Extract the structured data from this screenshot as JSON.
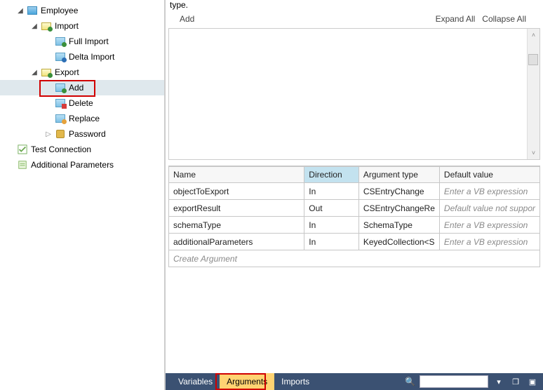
{
  "tree": {
    "root": "Employee",
    "import": {
      "label": "Import",
      "full": "Full Import",
      "delta": "Delta Import"
    },
    "export": {
      "label": "Export",
      "add": "Add",
      "delete": "Delete",
      "replace": "Replace",
      "password": "Password"
    },
    "testConnection": "Test Connection",
    "additionalParams": "Additional Parameters"
  },
  "remnant": "type.",
  "toolbar": {
    "add": "Add",
    "expandAll": "Expand All",
    "collapseAll": "Collapse All"
  },
  "grid": {
    "headers": {
      "name": "Name",
      "direction": "Direction",
      "argType": "Argument type",
      "defaultVal": "Default value"
    },
    "rows": [
      {
        "name": "objectToExport",
        "direction": "In",
        "argType": "CSEntryChange",
        "defaultVal": "Enter a VB expression",
        "ph": true
      },
      {
        "name": "exportResult",
        "direction": "Out",
        "argType": "CSEntryChangeRe",
        "defaultVal": "Default value not suppor",
        "ph": true
      },
      {
        "name": "schemaType",
        "direction": "In",
        "argType": "SchemaType",
        "defaultVal": "Enter a VB expression",
        "ph": true
      },
      {
        "name": "additionalParameters",
        "direction": "In",
        "argType": "KeyedCollection<S",
        "defaultVal": "Enter a VB expression",
        "ph": true
      }
    ],
    "createRow": "Create Argument"
  },
  "bottom": {
    "variables": "Variables",
    "arguments": "Arguments",
    "imports": "Imports"
  }
}
